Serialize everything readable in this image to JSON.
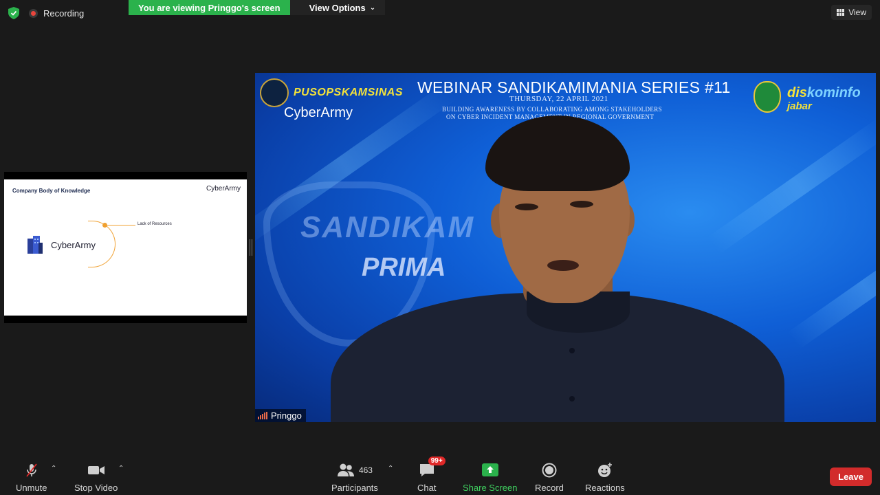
{
  "top": {
    "recording_label": "Recording",
    "viewing_banner": "You are viewing Pringgo's screen",
    "view_options_label": "View Options",
    "view_label": "View"
  },
  "thumbnail": {
    "slide_title": "Company Body of Knowledge",
    "slide_logo_top": "CyberArmy",
    "slide_logo_center": "CyberArmy",
    "slide_item_label": "Lack of Resources"
  },
  "video": {
    "org_name": "PUSOPSKAMSINAS",
    "cyberarmy_logo": "CyberArmy",
    "webinar_title": "WEBINAR SANDIKAMIMANIA SERIES #11",
    "webinar_date": "THURSDAY, 22 APRIL 2021",
    "webinar_sub1": "BUILDING AWARENESS BY COLLABORATING AMONG STAKEHOLDERS",
    "webinar_sub2": "ON CYBER INCIDENT MANAGEMENT IN REGIONAL GOVERNMENT",
    "diskominfo_a": "dis",
    "diskominfo_b": "kominfo",
    "jabar": "jabar",
    "watermark_top": "SANDIKAM",
    "watermark_bottom": "PRIMA",
    "speaker_name": "Pringgo"
  },
  "toolbar": {
    "unmute_label": "Unmute",
    "stop_video_label": "Stop Video",
    "participants_label": "Participants",
    "participants_count": "463",
    "chat_label": "Chat",
    "chat_badge": "99+",
    "share_screen_label": "Share Screen",
    "record_label": "Record",
    "reactions_label": "Reactions",
    "leave_label": "Leave"
  },
  "colors": {
    "share_green": "#2bb24c",
    "leave_red": "#d22b2b",
    "badge_red": "#e02828",
    "accent_orange": "#f0a030"
  }
}
